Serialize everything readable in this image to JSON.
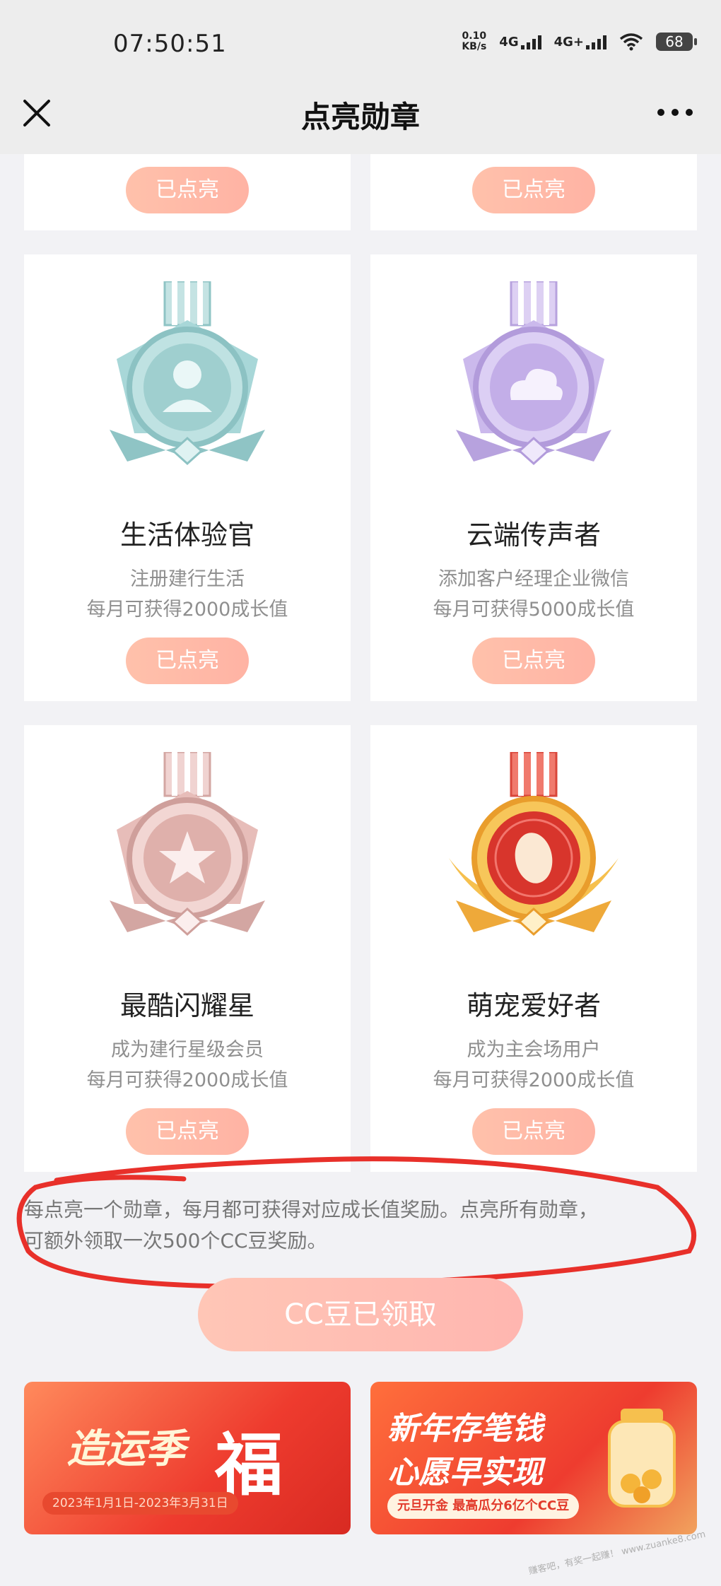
{
  "status_bar": {
    "time": "07:50:51",
    "net_speed_value": "0.10",
    "net_speed_unit": "KB/s",
    "signal1": "4G",
    "signal2": "4G+",
    "battery": "68"
  },
  "nav": {
    "title": "点亮勋章"
  },
  "top_row": [
    {
      "button": "已点亮"
    },
    {
      "button": "已点亮"
    }
  ],
  "medals": [
    {
      "name": "生活体验官",
      "desc1": "注册建行生活",
      "desc2": "每月可获得2000成长值",
      "button": "已点亮",
      "icon": "person-icon",
      "color": "#9fd3d4"
    },
    {
      "name": "云端传声者",
      "desc1": "添加客户经理企业微信",
      "desc2": "每月可获得5000成长值",
      "button": "已点亮",
      "icon": "cloud-icon",
      "color": "#c7b5e8"
    },
    {
      "name": "最酷闪耀星",
      "desc1": "成为建行星级会员",
      "desc2": "每月可获得2000成长值",
      "button": "已点亮",
      "icon": "star-icon",
      "color": "#e7b8b4"
    },
    {
      "name": "萌宠爱好者",
      "desc1": "成为主会场用户",
      "desc2": "每月可获得2000成长值",
      "button": "已点亮",
      "icon": "bean-icon",
      "color": "#f2b543"
    }
  ],
  "footnote": {
    "line1": "每点亮一个勋章，每月都可获得对应成长值奖励。点亮所有勋章，",
    "line2": "可额外领取一次500个CC豆奖励。"
  },
  "cc_button": "CC豆已领取",
  "banners": [
    {
      "title": "造运季",
      "fu": "福",
      "date": "2023年1月1日-2023年3月31日"
    },
    {
      "line1": "新年存笔钱",
      "line2": "心愿早实现",
      "sub": "元旦开金 最高瓜分6亿个CC豆"
    }
  ],
  "watermark": "赚客吧，有奖一起赚！ www.zuanke8.com"
}
